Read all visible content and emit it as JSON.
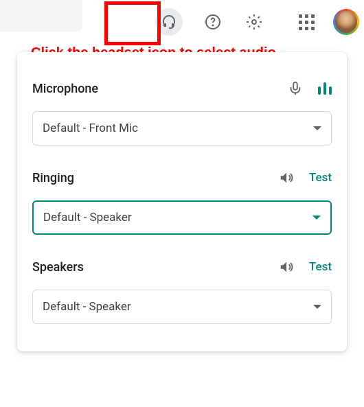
{
  "annotation": "Click the headset icon to select audio devices.",
  "sections": {
    "microphone": {
      "title": "Microphone",
      "selected": "Default - Front Mic"
    },
    "ringing": {
      "title": "Ringing",
      "test_label": "Test",
      "selected": "Default - Speaker"
    },
    "speakers": {
      "title": "Speakers",
      "test_label": "Test",
      "selected": "Default - Speaker"
    }
  }
}
